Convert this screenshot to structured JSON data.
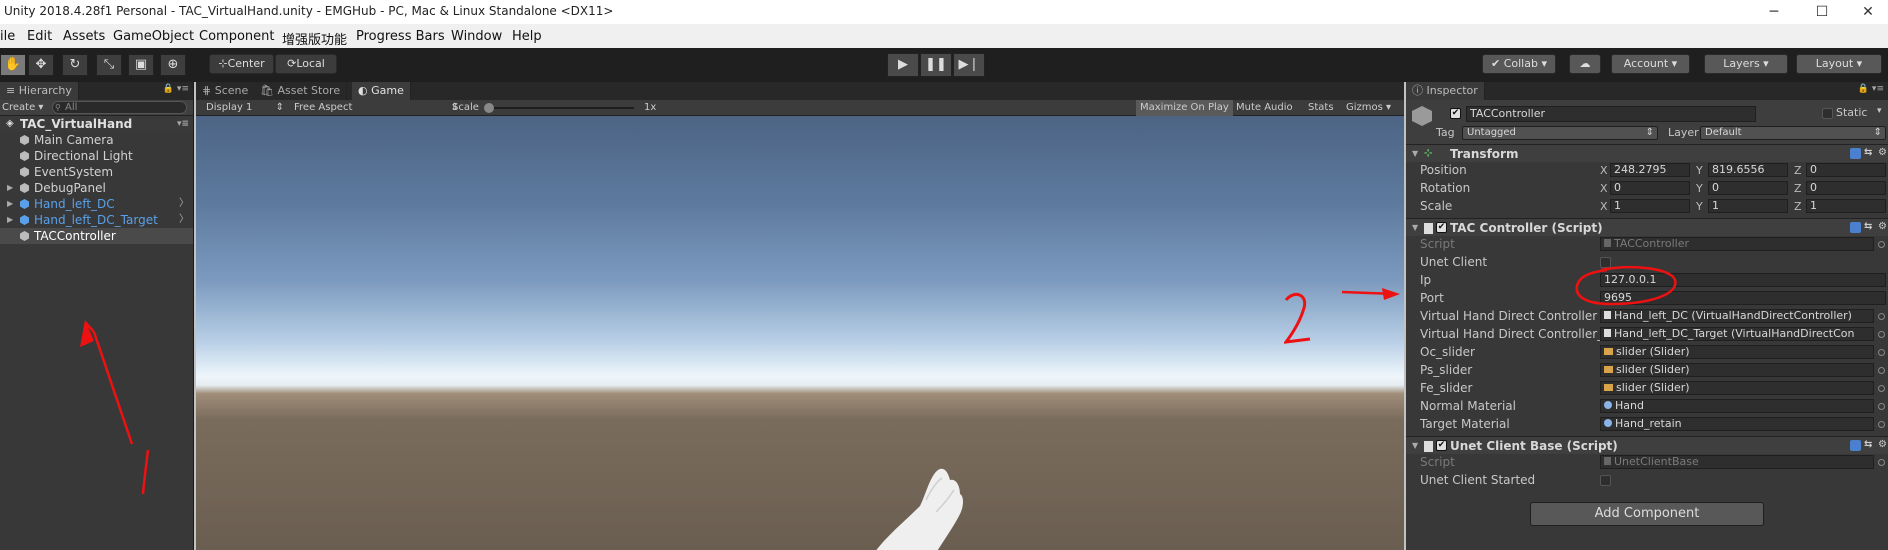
{
  "window": {
    "title": "Unity 2018.4.28f1 Personal - TAC_VirtualHand.unity - EMGHub - PC, Mac & Linux Standalone <DX11>",
    "minimize": "─",
    "maximize": "☐",
    "close": "✕"
  },
  "menu": [
    "ile",
    "Edit",
    "Assets",
    "GameObject",
    "Component",
    "增强版功能",
    "Progress Bars",
    "Window",
    "Help"
  ],
  "toolbar": {
    "pivot": "Center",
    "space": "Local",
    "collab": "Collab",
    "account": "Account",
    "layers": "Layers",
    "layout": "Layout"
  },
  "hierarchy": {
    "tab": "Hierarchy",
    "create": "Create",
    "search_placeholder": "All",
    "scene": "TAC_VirtualHand",
    "items": [
      {
        "label": "Main Camera",
        "prefab": false
      },
      {
        "label": "Directional Light",
        "prefab": false
      },
      {
        "label": "EventSystem",
        "prefab": false
      },
      {
        "label": "DebugPanel",
        "prefab": false
      },
      {
        "label": "Hand_left_DC",
        "prefab": true
      },
      {
        "label": "Hand_left_DC_Target",
        "prefab": true
      },
      {
        "label": "TACController",
        "prefab": false,
        "selected": true
      }
    ]
  },
  "center_tabs": {
    "scene": "Scene",
    "asset_store": "Asset Store",
    "game": "Game"
  },
  "game_toolbar": {
    "display": "Display 1",
    "aspect": "Free Aspect",
    "scale_label": "Scale",
    "scale_value": "1x",
    "maximize_on_play": "Maximize On Play",
    "mute_audio": "Mute Audio",
    "stats": "Stats",
    "gizmos": "Gizmos"
  },
  "annotations": {
    "arrow_left_number": "1",
    "arrow_right_number": "2",
    "color": "#ee1111"
  },
  "inspector": {
    "tab": "Inspector",
    "object_name": "TACController",
    "static_label": "Static",
    "tag_label": "Tag",
    "tag_value": "Untagged",
    "layer_label": "Layer",
    "layer_value": "Default",
    "transform": {
      "title": "Transform",
      "position_label": "Position",
      "rotation_label": "Rotation",
      "scale_label": "Scale",
      "position": {
        "x": "248.2795",
        "y": "819.6556",
        "z": "0"
      },
      "rotation": {
        "x": "0",
        "y": "0",
        "z": "0"
      },
      "scale": {
        "x": "1",
        "y": "1",
        "z": "1"
      }
    },
    "tac_controller": {
      "title": "TAC Controller (Script)",
      "script_label": "Script",
      "script_value": "TACController",
      "unet_client_label": "Unet Client",
      "ip_label": "Ip",
      "ip_value": "127.0.0.1",
      "port_label": "Port",
      "port_value": "9695",
      "vhdc_label": "Virtual Hand Direct Controller",
      "vhdc_value": "Hand_left_DC (VirtualHandDirectController)",
      "vhdc_target_label": "Virtual Hand Direct Controller_",
      "vhdc_target_value": "Hand_left_DC_Target (VirtualHandDirectCon",
      "oc_slider_label": "Oc_slider",
      "oc_slider_value": "slider (Slider)",
      "ps_slider_label": "Ps_slider",
      "ps_slider_value": "slider (Slider)",
      "fe_slider_label": "Fe_slider",
      "fe_slider_value": "slider (Slider)",
      "normal_material_label": "Normal Material",
      "normal_material_value": "Hand",
      "target_material_label": "Target Material",
      "target_material_value": "Hand_retain"
    },
    "unet_client_base": {
      "title": "Unet Client Base (Script)",
      "script_label": "Script",
      "script_value": "UnetClientBase",
      "started_label": "Unet Client Started"
    },
    "add_component": "Add Component"
  }
}
